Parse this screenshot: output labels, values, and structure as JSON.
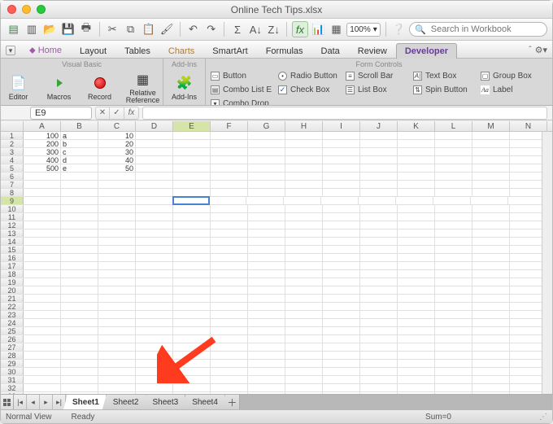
{
  "window": {
    "title": "Online Tech Tips.xlsx"
  },
  "qat": {
    "zoom": "100%"
  },
  "search": {
    "placeholder": "Search in Workbook"
  },
  "tabs": {
    "items": [
      "Home",
      "Layout",
      "Tables",
      "Charts",
      "SmartArt",
      "Formulas",
      "Data",
      "Review",
      "Developer"
    ],
    "active_index": 8
  },
  "ribbon": {
    "vb_group_title": "Visual Basic",
    "vb_editor": "Editor",
    "vb_macros": "Macros",
    "vb_record": "Record",
    "vb_relref": "Relative Reference",
    "addins_group_title": "Add-Ins",
    "addins_btn": "Add-Ins",
    "fc_group_title": "Form Controls",
    "fc": {
      "button": "Button",
      "radio": "Radio Button",
      "scroll": "Scroll Bar",
      "text": "Text Box",
      "group": "Group Box",
      "combo1": "Combo List E",
      "check": "Check Box",
      "list": "List Box",
      "spin": "Spin Button",
      "label": "Label",
      "combo2": "Combo Drop"
    }
  },
  "formula": {
    "namebox": "E9"
  },
  "grid": {
    "columns": [
      "A",
      "B",
      "C",
      "D",
      "E",
      "F",
      "G",
      "H",
      "I",
      "J",
      "K",
      "L",
      "M",
      "N"
    ],
    "row_count": 33,
    "active": {
      "col": "E",
      "row": 9
    },
    "data": {
      "1": {
        "A": "100",
        "B": "a",
        "C": "10"
      },
      "2": {
        "A": "200",
        "B": "b",
        "C": "20"
      },
      "3": {
        "A": "300",
        "B": "c",
        "C": "30"
      },
      "4": {
        "A": "400",
        "B": "d",
        "C": "40"
      },
      "5": {
        "A": "500",
        "B": "e",
        "C": "50"
      }
    }
  },
  "sheets": {
    "items": [
      "Sheet1",
      "Sheet2",
      "Sheet3",
      "Sheet4"
    ],
    "active_index": 0
  },
  "status": {
    "view": "Normal View",
    "ready": "Ready",
    "sum": "Sum=0"
  }
}
